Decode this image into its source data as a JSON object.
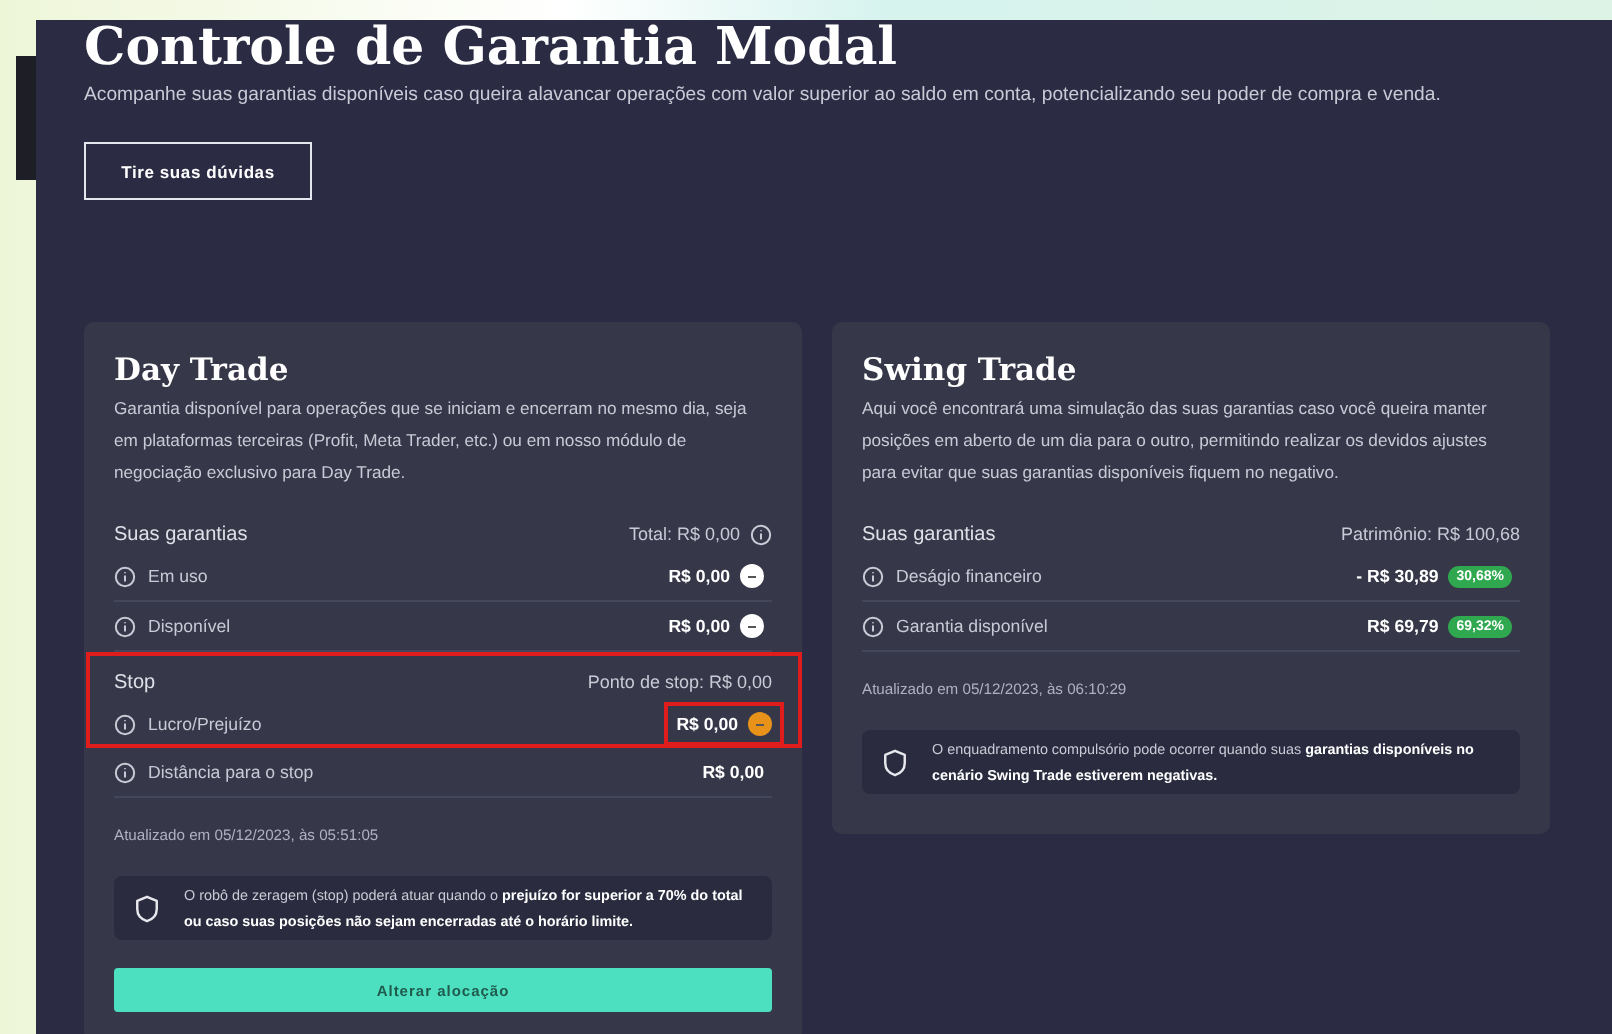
{
  "header": {
    "title": "Controle de Garantia Modal",
    "description": "Acompanhe suas garantias disponíveis caso queira alavancar operações com valor superior ao saldo em conta, potencializando seu poder de compra e venda.",
    "button": "Tire suas dúvidas"
  },
  "cards": [
    {
      "title": "Day Trade",
      "description": "Garantia disponível para operações que se iniciam e encerram no mesmo dia, seja em plataformas terceiras (Profit, Meta Trader, etc.) ou em nosso módulo de negociação exclusivo para Day Trade.",
      "sections": [
        {
          "heading": "Suas garantias",
          "summary": "Total: R$ 0,00",
          "summary_info": true,
          "highlighted": false,
          "rows": [
            {
              "label": "Em uso",
              "value": "R$ 0,00",
              "kind": "dot",
              "color": "#ffffff",
              "highlighted": false
            },
            {
              "label": "Disponível",
              "value": "R$ 0,00",
              "kind": "dot",
              "color": "#ffffff",
              "highlighted": false
            }
          ]
        },
        {
          "heading": "Stop",
          "summary": "Ponto de stop: R$ 0,00",
          "summary_info": false,
          "highlighted": true,
          "rows": [
            {
              "label": "Lucro/Prejuízo",
              "value": "R$ 0,00",
              "kind": "dot",
              "color": "#e8921a",
              "highlighted": true
            }
          ]
        },
        {
          "rows": [
            {
              "label": "Distância para o stop",
              "value": "R$ 0,00",
              "kind": "plain",
              "highlighted": false
            }
          ],
          "highlighted": false
        }
      ],
      "updated": "Atualizado em 05/12/2023, às 05:51:05",
      "notice": "O robô de zeragem (stop) poderá atuar quando o **prejuízo for superior a 70% do total ou caso suas posições não sejam encerradas até o horário limite.**",
      "button": "Alterar alocação"
    },
    {
      "title": "Swing Trade",
      "description": "Aqui você encontrará uma simulação das suas garantias caso você queira manter posições em aberto de um dia para o outro, permitindo realizar os devidos ajustes para evitar que suas garantias disponíveis fiquem no negativo.",
      "sections": [
        {
          "heading": "Suas garantias",
          "summary": "Patrimônio: R$ 100,68",
          "summary_info": false,
          "highlighted": false,
          "rows": [
            {
              "label": "Deságio financeiro",
              "value": "- R$ 30,89",
              "kind": "badge",
              "badge": "30,68%",
              "highlighted": false
            },
            {
              "label": "Garantia disponível",
              "value": "R$ 69,79",
              "kind": "badge",
              "badge": "69,32%",
              "highlighted": false
            }
          ]
        }
      ],
      "updated": "Atualizado em 05/12/2023, às 06:10:29",
      "notice": "O enquadramento compulsório pode ocorrer quando suas **garantias disponíveis no cenário Swing Trade estiverem negativas.**"
    }
  ]
}
